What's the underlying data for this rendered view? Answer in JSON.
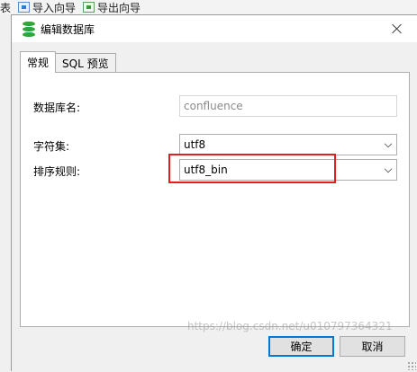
{
  "background_toolbar": {
    "leading_text": "表",
    "import_wizard": "导入向导",
    "export_wizard": "导出向导"
  },
  "dialog": {
    "title": "编辑数据库",
    "title_icon": "database-icon",
    "close_icon": "close-icon"
  },
  "tabs": [
    {
      "label": "常规",
      "active": true
    },
    {
      "label": "SQL 预览",
      "active": false
    }
  ],
  "form": {
    "db_name_label": "数据库名:",
    "db_name_value": "confluence",
    "charset_label": "字符集:",
    "charset_value": "utf8",
    "collation_label": "排序规则:",
    "collation_value": "utf8_bin"
  },
  "buttons": {
    "ok": "确定",
    "cancel": "取消"
  },
  "watermark": "https://blog.csdn.net/u010797364321",
  "colors": {
    "highlight": "#e02020",
    "primary_border": "#0078d7",
    "db_icon": "#2fa63a"
  }
}
